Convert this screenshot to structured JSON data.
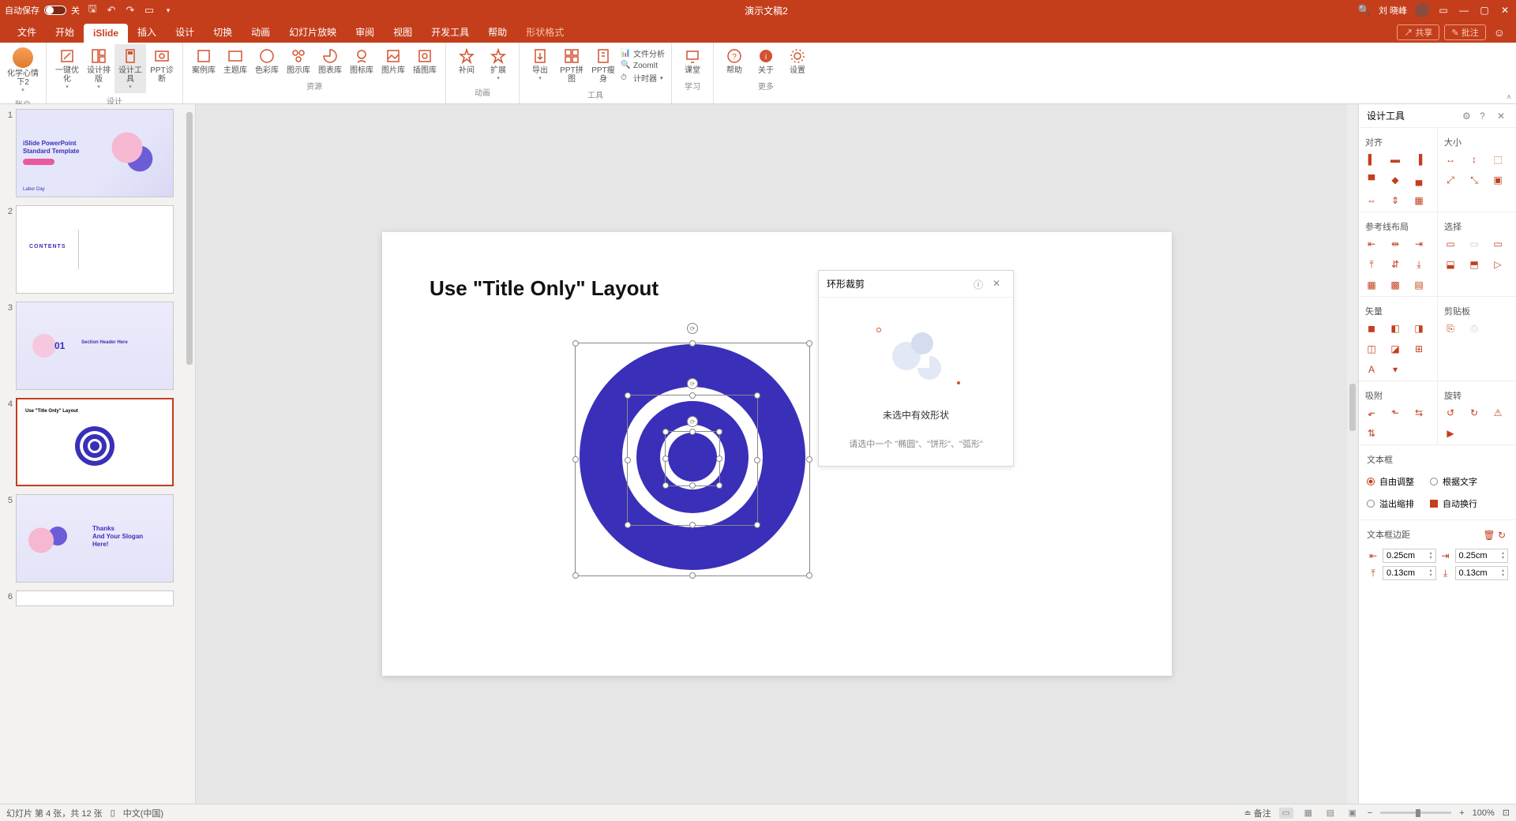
{
  "titlebar": {
    "autosave_label": "自动保存",
    "autosave_state": "关",
    "doc_title": "演示文稿2",
    "user_name": "刘 晓峰"
  },
  "tabs": {
    "file": "文件",
    "home": "开始",
    "islide": "iSlide",
    "insert": "插入",
    "design": "设计",
    "transition": "切换",
    "animation": "动画",
    "slideshow": "幻灯片放映",
    "review": "审阅",
    "view": "视图",
    "dev": "开发工具",
    "help": "帮助",
    "shape_format": "形状格式",
    "share": "共享",
    "comment": "批注"
  },
  "ribbon": {
    "account": {
      "mood": "化学心情下2",
      "group": "账户"
    },
    "design": {
      "optimize": "一键优化",
      "layout": "设计排版",
      "tools": "设计工具",
      "diag": "PPT诊断",
      "group": "设计"
    },
    "resource": {
      "case": "案例库",
      "theme": "主题库",
      "color": "色彩库",
      "chart": "图示库",
      "table": "图表库",
      "iconlib": "图标库",
      "piclib": "图片库",
      "illus": "插图库",
      "group": "资源"
    },
    "anim": {
      "supplement": "补间",
      "extend": "扩展",
      "group": "动画"
    },
    "tool": {
      "export": "导出",
      "pptpj": "PPT拼图",
      "pptss": "PPT瘦身",
      "fileanalysis": "文件分析",
      "zoomit": "ZoomIt",
      "timer": "计时器",
      "group": "工具"
    },
    "study": {
      "class": "课堂",
      "group": "学习"
    },
    "more": {
      "help": "帮助",
      "about": "关于",
      "setting": "设置",
      "group": "更多"
    }
  },
  "thumbs": [
    {
      "n": "1",
      "title1": "iSlide PowerPoint",
      "title2": "Standard Template",
      "footer": "Labor Day"
    },
    {
      "n": "2",
      "label": "CONTENTS"
    },
    {
      "n": "3",
      "num": "01",
      "title": "Section Header Here"
    },
    {
      "n": "4",
      "title": "Use \"Title Only\" Layout"
    },
    {
      "n": "5",
      "line1": "Thanks",
      "line2": "And Your Slogan",
      "line3": "Here!"
    },
    {
      "n": "6"
    }
  ],
  "slide": {
    "title": "Use \"Title Only\" Layout"
  },
  "crop_panel": {
    "title": "环形裁剪",
    "msg1": "未选中有效形状",
    "msg2": "请选中一个 \"椭圆\"、\"饼形\"、\"弧形\""
  },
  "design_pane": {
    "title": "设计工具",
    "align": "对齐",
    "size": "大小",
    "guides": "参考线布局",
    "select": "选择",
    "vector": "矢量",
    "clipboard": "剪贴板",
    "snap": "吸附",
    "rotate": "旋转",
    "textbox": "文本框",
    "auto_resize": "自由调整",
    "by_text": "根据文字",
    "overflow": "溢出缩排",
    "autowrap": "自动换行",
    "margins_label": "文本框边距",
    "margin_left": "0.25cm",
    "margin_right": "0.25cm",
    "margin_top": "0.13cm",
    "margin_bottom": "0.13cm"
  },
  "statusbar": {
    "slide_info": "幻灯片 第 4 张，共 12 张",
    "lang": "中文(中国)",
    "notes": "备注",
    "zoom": "100%"
  },
  "colors": {
    "brand": "#c43e1c",
    "islide_accent": "#d35230",
    "shape_fill": "#3a2fb8"
  }
}
